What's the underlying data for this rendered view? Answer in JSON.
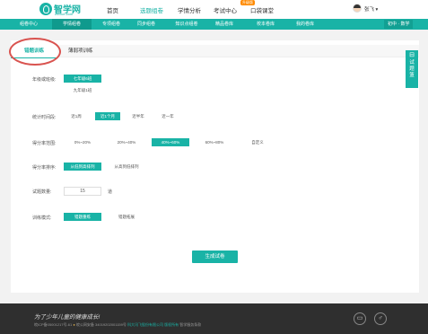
{
  "header": {
    "logo_title": "智学网",
    "logo_sub": "zhixue.com",
    "nav": [
      "首页",
      "选题组卷",
      "学情分析",
      "考试中心",
      "口袋课堂"
    ],
    "nav_badge": "升级版",
    "username": "张飞"
  },
  "subnav": {
    "items": [
      "组卷中心",
      "学情组卷",
      "专项组卷",
      "同步组卷",
      "知识点组卷",
      "精品卷库",
      "校本卷库",
      "我的卷库"
    ],
    "grade": "初中 · 数学"
  },
  "tabs": [
    "错题训练",
    "薄弱项训练"
  ],
  "form": {
    "class_label": "年级或班级:",
    "class_options": [
      "七年级6班",
      "九年级1班"
    ],
    "time_label": "统计时间段:",
    "time_options": [
      "近1周",
      "近1个月",
      "近半年",
      "近一年"
    ],
    "score_label": "得分率范围:",
    "score_options": [
      "0%~20%",
      "20%~40%",
      "40%~60%",
      "60%~80%",
      "自定义"
    ],
    "sort_label": "得分率排序:",
    "sort_options": [
      "从低到高排列",
      "从高到低排列"
    ],
    "count_label": "试题数量:",
    "count_value": "15",
    "count_unit": "道",
    "mode_label": "训练模式:",
    "mode_options": [
      "错题重练",
      "错题拓展"
    ],
    "generate_button": "生成试卷"
  },
  "side_tab": {
    "icon": "basket-icon",
    "label": "试题篮"
  },
  "footer": {
    "slogan": "为了少年儿童的健康成长!",
    "icp": "皖ICP备05001217号-61",
    "police": "皖公网安备 34019202001159号",
    "company": "科大讯飞股份有限公司 版权所有",
    "service": "智学服务条款"
  },
  "colors": {
    "accent": "#19b3a6",
    "highlight_ring": "#d9534f",
    "footer_bg": "#2f2f2f"
  }
}
